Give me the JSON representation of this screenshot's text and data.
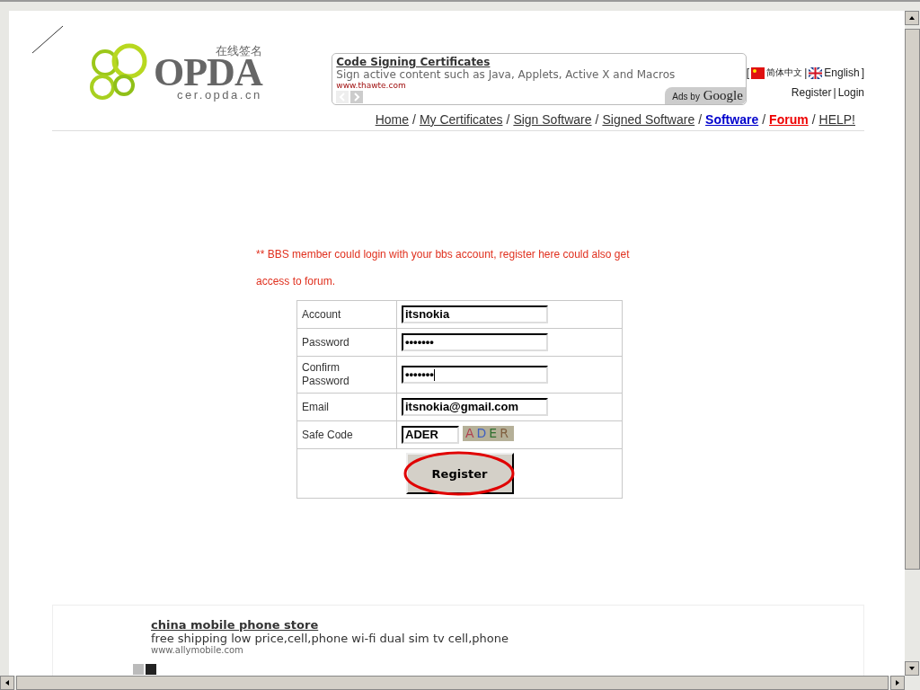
{
  "logo": {
    "chinese": "在线签名",
    "name": "OPDA",
    "domain": "cer.opda.cn"
  },
  "top_ad": {
    "title": "Code Signing Certificates",
    "text": "Sign active content such as Java, Applets, Active X and Macros",
    "url": "www.thawte.com",
    "badge_small": "Ads by",
    "badge_brand": "Google"
  },
  "language": {
    "open": "[",
    "chinese": "简体中文",
    "separator": "|",
    "english": "English",
    "close": "]"
  },
  "account_links": [
    {
      "label": "Register"
    },
    {
      "label": "Login"
    }
  ],
  "account_separator": "|",
  "nav": [
    {
      "label": "Home",
      "kind": "plain"
    },
    {
      "label": "My Certificates",
      "kind": "plain"
    },
    {
      "label": "Sign Software",
      "kind": "plain"
    },
    {
      "label": "Signed Software",
      "kind": "plain"
    },
    {
      "label": "Software",
      "kind": "blue"
    },
    {
      "label": "Forum",
      "kind": "red"
    },
    {
      "label": "HELP!",
      "kind": "plain"
    }
  ],
  "nav_separator": "/",
  "notice": "** BBS member could login with your bbs account, register here could also get access to forum.",
  "form": {
    "rows": [
      {
        "label": "Account",
        "value": "itsnokia",
        "kind": "text"
      },
      {
        "label": "Password",
        "value": "•••••••",
        "kind": "text"
      },
      {
        "label": "Confirm Password",
        "value": "•••••••",
        "kind": "text",
        "focused": true
      },
      {
        "label": "Email",
        "value": "itsnokia@gmail.com",
        "kind": "text"
      },
      {
        "label": "Safe Code",
        "value": "ADER",
        "kind": "captcha",
        "captcha": [
          "A",
          "D",
          "E",
          "R"
        ]
      }
    ],
    "submit": "Register"
  },
  "bottom_ad": {
    "title": "china mobile phone store",
    "text": "free shipping low price,cell,phone wi-fi dual sim tv cell,phone",
    "url": "www.allymobile.com"
  }
}
